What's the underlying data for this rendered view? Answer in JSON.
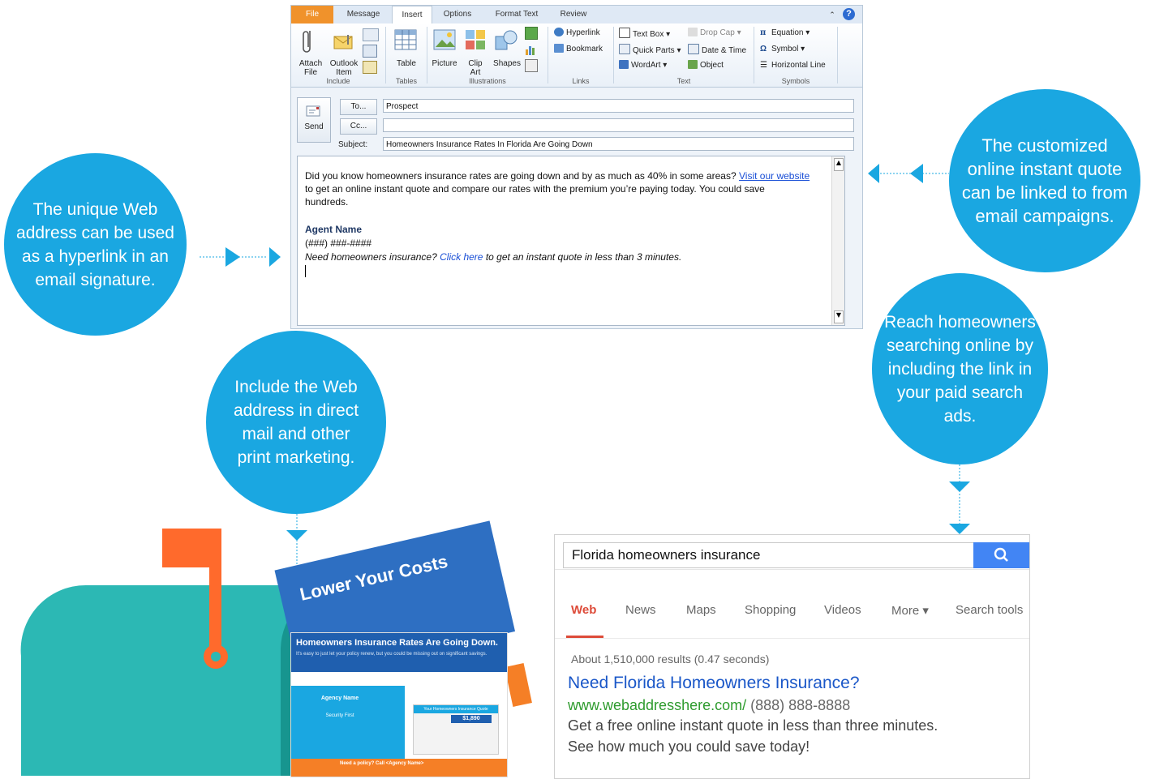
{
  "outlook": {
    "tabs": [
      "File",
      "Message",
      "Insert",
      "Options",
      "Format Text",
      "Review"
    ],
    "active_tab": "Insert",
    "groups": {
      "include": {
        "label": "Include",
        "attach_file": "Attach\nFile",
        "outlook_item": "Outlook\nItem"
      },
      "tables": {
        "label": "Tables",
        "table": "Table"
      },
      "illustrations": {
        "label": "Illustrations",
        "picture": "Picture",
        "clip_art": "Clip\nArt",
        "shapes": "Shapes"
      },
      "links": {
        "label": "Links",
        "hyperlink": "Hyperlink",
        "bookmark": "Bookmark"
      },
      "text": {
        "label": "Text",
        "text_box": "Text Box ▾",
        "quick_parts": "Quick Parts ▾",
        "wordart": "WordArt ▾",
        "drop_cap": "Drop Cap ▾",
        "date_time": "Date & Time",
        "object": "Object"
      },
      "symbols": {
        "label": "Symbols",
        "equation": "Equation ▾",
        "symbol": "Symbol ▾",
        "horizontal_line": "Horizontal Line"
      }
    },
    "compose": {
      "send": "Send",
      "to_button": "To...",
      "cc_button": "Cc...",
      "subject_label": "Subject:",
      "to_value": "Prospect",
      "cc_value": "",
      "subject_value": "Homeowners Insurance Rates In Florida Are Going Down"
    },
    "body": {
      "line1": "Did you know homeowners insurance rates are going down and by as much as 40% in some areas?",
      "line1_link": "Visit our website",
      "line2": "to get an online instant quote and compare our rates with the premium you’re paying today. You could save",
      "line3": "hundreds.",
      "agent_name": "Agent Name",
      "phone": "(###) ###-####",
      "sig_pre": "Need homeowners insurance?",
      "sig_link": "Click here",
      "sig_post": "to get an instant quote in less than 3 minutes."
    }
  },
  "bubbles": {
    "web_address": "The unique Web address can be used as a hyperlink in  an email signature.",
    "custom_quote": "The customized online instant quote can be linked to from email campaigns.",
    "direct_mail": "Include the Web address in direct mail and other print marketing.",
    "paid_search": "Reach homeowners searching online by including the link in your paid search ads."
  },
  "search": {
    "query": "Florida homeowners insurance",
    "tabs": [
      "Web",
      "News",
      "Maps",
      "Shopping",
      "Videos",
      "More ▾",
      "Search tools"
    ],
    "active_tab": "Web",
    "stats": "About 1,510,000 results (0.47 seconds)",
    "ad_title": "Need Florida Homeowners Insurance?",
    "ad_url": "www.webaddresshere.com/",
    "ad_phone": "(888) 888-8888",
    "ad_desc1": "Get a free online instant quote in less than three minutes.",
    "ad_desc2": "See how much you could save today!"
  },
  "mailer": {
    "headline": "Lower Your Costs",
    "front_title": "Homeowners Insurance Rates Are Going Down.",
    "front_subtitle": "It's easy to just let your policy renew, but you could be missing out on significant savings.",
    "agency": "Agency Name",
    "partner": "Security First",
    "quote_title": "Your Homeowners Insurance Quote",
    "premium": "$1,890",
    "cta": "Need a policy? Call <Agency Name>"
  },
  "colors": {
    "bubble": "#1aa7e1",
    "arrow": "#1aa7e1",
    "mailbox": "#2cb8b4",
    "flag": "#ff6a2c",
    "google_blue": "#4285f4",
    "web_tab_red": "#dd4b39",
    "ad_title": "#1a0dab",
    "ad_url": "#2e9b2e"
  }
}
